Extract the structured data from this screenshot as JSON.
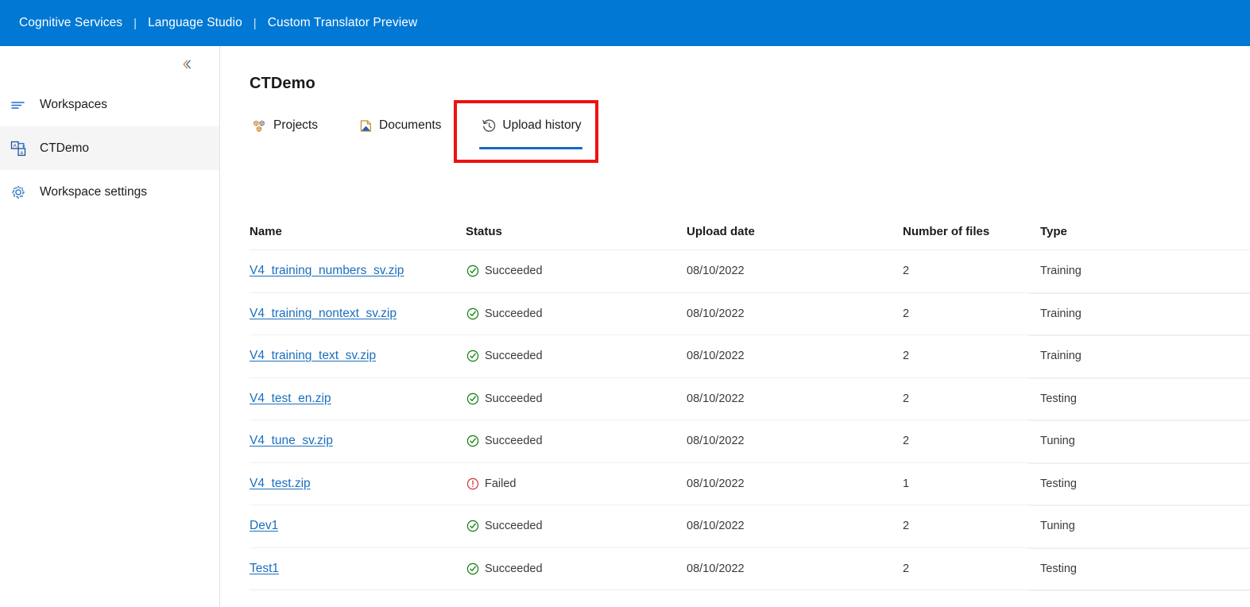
{
  "topbar": {
    "links": [
      {
        "label": "Cognitive Services"
      },
      {
        "label": "Language Studio"
      },
      {
        "label": "Custom Translator Preview"
      }
    ],
    "separator": "|",
    "background_color": "#0078d4"
  },
  "sidebar": {
    "collapse_icon": "chevron-double-left-icon",
    "items": [
      {
        "label": "Workspaces",
        "icon": "list-lines-icon",
        "selected": false
      },
      {
        "label": "CTDemo",
        "icon": "translate-icon",
        "selected": true
      },
      {
        "label": "Workspace settings",
        "icon": "gear-icon",
        "selected": false
      }
    ]
  },
  "main": {
    "title": "CTDemo",
    "tabs": [
      {
        "label": "Projects",
        "icon": "projects-cubes-icon",
        "active": false
      },
      {
        "label": "Documents",
        "icon": "document-icon",
        "active": false
      },
      {
        "label": "Upload history",
        "icon": "history-clock-icon",
        "active": true
      }
    ],
    "highlight": {
      "color": "#ee1111",
      "target": "Upload history"
    },
    "table": {
      "columns": [
        "Name",
        "Status",
        "Upload date",
        "Number of files",
        "Type"
      ],
      "rows": [
        {
          "name": "V4_training_numbers_sv.zip",
          "status": "Succeeded",
          "status_icon": "check-circle-icon",
          "date": "08/10/2022",
          "files": "2",
          "type": "Training"
        },
        {
          "name": "V4_training_nontext_sv.zip",
          "status": "Succeeded",
          "status_icon": "check-circle-icon",
          "date": "08/10/2022",
          "files": "2",
          "type": "Training"
        },
        {
          "name": "V4_training_text_sv.zip",
          "status": "Succeeded",
          "status_icon": "check-circle-icon",
          "date": "08/10/2022",
          "files": "2",
          "type": "Training"
        },
        {
          "name": "V4_test_en.zip",
          "status": "Succeeded",
          "status_icon": "check-circle-icon",
          "date": "08/10/2022",
          "files": "2",
          "type": "Testing"
        },
        {
          "name": "V4_tune_sv.zip",
          "status": "Succeeded",
          "status_icon": "check-circle-icon",
          "date": "08/10/2022",
          "files": "2",
          "type": "Tuning"
        },
        {
          "name": "V4_test.zip",
          "status": "Failed",
          "status_icon": "error-circle-icon",
          "date": "08/10/2022",
          "files": "1",
          "type": "Testing"
        },
        {
          "name": "Dev1",
          "status": "Succeeded",
          "status_icon": "check-circle-icon",
          "date": "08/10/2022",
          "files": "2",
          "type": "Tuning"
        },
        {
          "name": "Test1",
          "status": "Succeeded",
          "status_icon": "check-circle-icon",
          "date": "08/10/2022",
          "files": "2",
          "type": "Testing"
        }
      ]
    }
  },
  "colors": {
    "accent_blue": "#0078d4",
    "link_blue": "#1a6ebd",
    "tab_underline": "#1569c7",
    "success_green": "#107c10",
    "error_red": "#d13438",
    "highlight_red": "#ee1111"
  }
}
